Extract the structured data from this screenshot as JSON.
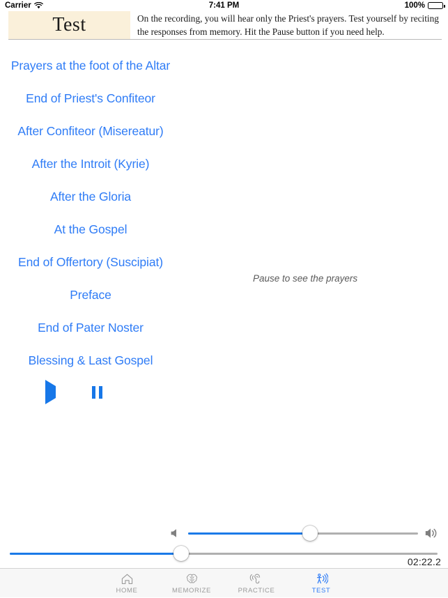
{
  "status_bar": {
    "carrier": "Carrier",
    "wifi_icon": "wifi-icon",
    "time": "7:41 PM",
    "battery_percent": "100%",
    "battery_icon": "battery-icon"
  },
  "header": {
    "title": "Test",
    "title_bg": "#faf0da",
    "description": "On the recording, you will hear only the Priest's prayers. Test yourself by reciting the responses from memory. Hit the Pause button if you need help."
  },
  "prayer_links": [
    {
      "label": "Prayers at the foot of the Altar"
    },
    {
      "label": "End of Priest's Confiteor"
    },
    {
      "label": "After Confiteor (Misereatur)"
    },
    {
      "label": "After the Introit (Kyrie)"
    },
    {
      "label": "After the Gloria"
    },
    {
      "label": "At the Gospel"
    },
    {
      "label": "End of Offertory (Suscipiat)"
    },
    {
      "label": "Preface"
    },
    {
      "label": "End of Pater Noster"
    },
    {
      "label": "Blessing & Last Gospel"
    }
  ],
  "transport": {
    "play_icon": "play-icon",
    "pause_icon": "pause-icon",
    "stop_icon": "stop-icon",
    "accent_color": "#1777e8"
  },
  "hint": {
    "text": "Pause to see the prayers"
  },
  "volume_slider": {
    "mute_icon": "speaker-mute-icon",
    "volume_icon": "speaker-high-icon",
    "value_percent": 53,
    "fill_color": "#1b7ae8",
    "track_color": "#b0b0b0"
  },
  "progress_slider": {
    "value_percent": 40,
    "fill_color": "#1b7ae8",
    "track_color": "#b0b0b0",
    "time_elapsed": "02:22.2"
  },
  "tabbar": {
    "accent_color": "#2f7cf6",
    "inactive_color": "#9a9a9a",
    "items": [
      {
        "label": "HOME",
        "icon": "home-icon",
        "active": false
      },
      {
        "label": "MEMORIZE",
        "icon": "brain-icon",
        "active": false
      },
      {
        "label": "PRACTICE",
        "icon": "ear-listen-icon",
        "active": false
      },
      {
        "label": "TEST",
        "icon": "speaking-person-icon",
        "active": true
      }
    ]
  }
}
